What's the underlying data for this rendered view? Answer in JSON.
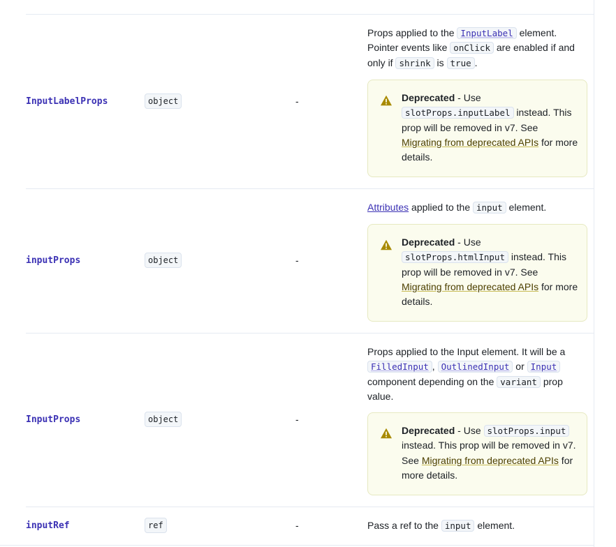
{
  "rows": [
    {
      "name": "InputLabelProps",
      "type": "object",
      "default": "-",
      "desc": {
        "t1": "Props applied to the ",
        "c1": "InputLabel",
        "t2": " element. Pointer events like ",
        "c2": "onClick",
        "t3": " are enabled if and only if ",
        "c3": "shrink",
        "t4": " is ",
        "c4": "true",
        "t5": "."
      },
      "deprecation": {
        "label": "Deprecated",
        "t1": " - Use ",
        "code": "slotProps.inputLabel",
        "t2": " instead. This prop will be removed in v7. See ",
        "link": "Migrating from deprecated APIs",
        "t3": " for more details."
      }
    },
    {
      "name": "inputProps",
      "type": "object",
      "default": "-",
      "desc": {
        "link": "Attributes",
        "t1": " applied to the ",
        "c1": "input",
        "t2": " element."
      },
      "deprecation": {
        "label": "Deprecated",
        "t1": " - Use ",
        "code": "slotProps.htmlInput",
        "t2": " instead. This prop will be removed in v7. See ",
        "link": "Migrating from deprecated APIs",
        "t3": " for more details."
      }
    },
    {
      "name": "InputProps",
      "type": "object",
      "default": "-",
      "desc": {
        "t1": "Props applied to the Input element. It will be a ",
        "c1": "FilledInput",
        "t2": ", ",
        "c2": "OutlinedInput",
        "t3": " or ",
        "c3": "Input",
        "t4": " component depending on the ",
        "c4": "variant",
        "t5": " prop value."
      },
      "deprecation": {
        "label": "Deprecated",
        "t1": " - Use ",
        "code": "slotProps.input",
        "t2": " instead. This prop will be removed in v7. See ",
        "link": "Migrating from deprecated APIs",
        "t3": " for more details."
      }
    },
    {
      "name": "inputRef",
      "type": "ref",
      "default": "-",
      "desc": {
        "t1": "Pass a ref to the ",
        "c1": "input",
        "t2": " element."
      }
    }
  ],
  "colors": {
    "prop_name": "#3b31b4",
    "callout_bg": "#fbfcee",
    "callout_border": "#e6e9c1",
    "warning_icon": "#a88a00",
    "divider": "#e5eaf2"
  },
  "icons": {
    "deprecation": "warning-triangle-icon"
  }
}
